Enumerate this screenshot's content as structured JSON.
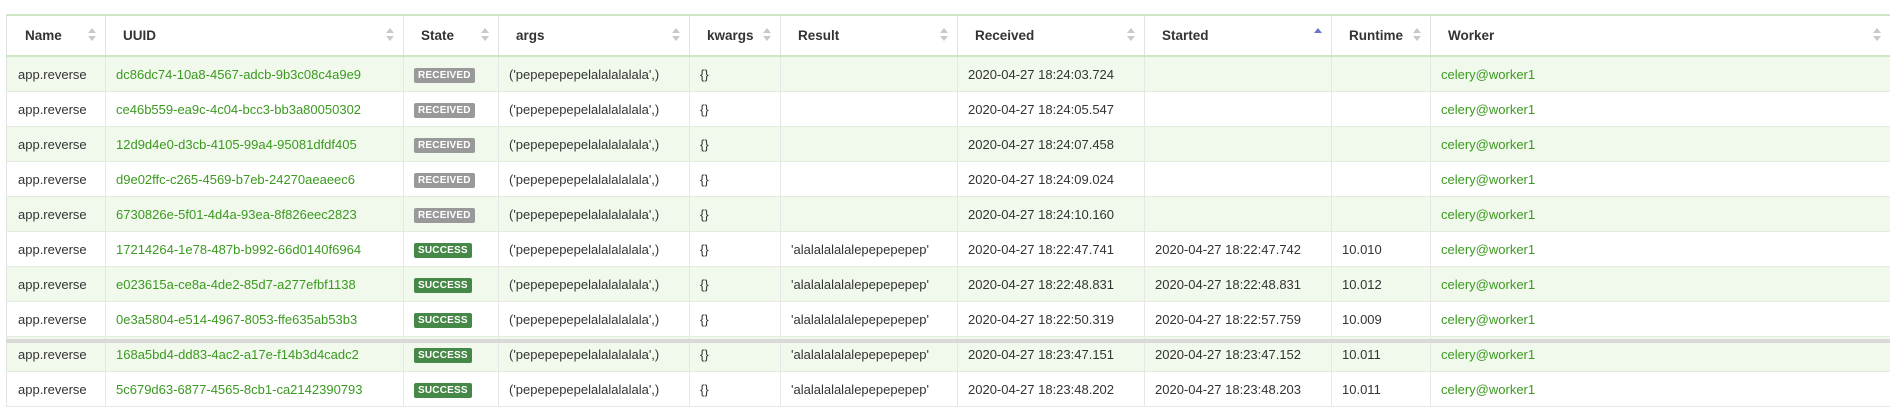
{
  "columns": [
    "Name",
    "UUID",
    "State",
    "args",
    "kwargs",
    "Result",
    "Received",
    "Started",
    "Runtime",
    "Worker"
  ],
  "sort_active_column": "Started",
  "state_colors": {
    "RECEIVED": "#999999",
    "SUCCESS": "#468847"
  },
  "link_color": "#3a9a1f",
  "rows": [
    {
      "name": "app.reverse",
      "uuid": "dc86dc74-10a8-4567-adcb-9b3c08c4a9e9",
      "state": "RECEIVED",
      "args": "('pepepepepelalalalalala',)",
      "kwargs": "{}",
      "result": "",
      "received": "2020-04-27 18:24:03.724",
      "started": "",
      "runtime": "",
      "worker": "celery@worker1"
    },
    {
      "name": "app.reverse",
      "uuid": "ce46b559-ea9c-4c04-bcc3-bb3a80050302",
      "state": "RECEIVED",
      "args": "('pepepepepelalalalalala',)",
      "kwargs": "{}",
      "result": "",
      "received": "2020-04-27 18:24:05.547",
      "started": "",
      "runtime": "",
      "worker": "celery@worker1"
    },
    {
      "name": "app.reverse",
      "uuid": "12d9d4e0-d3cb-4105-99a4-95081dfdf405",
      "state": "RECEIVED",
      "args": "('pepepepepelalalalalala',)",
      "kwargs": "{}",
      "result": "",
      "received": "2020-04-27 18:24:07.458",
      "started": "",
      "runtime": "",
      "worker": "celery@worker1"
    },
    {
      "name": "app.reverse",
      "uuid": "d9e02ffc-c265-4569-b7eb-24270aeaeec6",
      "state": "RECEIVED",
      "args": "('pepepepepelalalalalala',)",
      "kwargs": "{}",
      "result": "",
      "received": "2020-04-27 18:24:09.024",
      "started": "",
      "runtime": "",
      "worker": "celery@worker1"
    },
    {
      "name": "app.reverse",
      "uuid": "6730826e-5f01-4d4a-93ea-8f826eec2823",
      "state": "RECEIVED",
      "args": "('pepepepepelalalalalala',)",
      "kwargs": "{}",
      "result": "",
      "received": "2020-04-27 18:24:10.160",
      "started": "",
      "runtime": "",
      "worker": "celery@worker1"
    },
    {
      "name": "app.reverse",
      "uuid": "17214264-1e78-487b-b992-66d0140f6964",
      "state": "SUCCESS",
      "args": "('pepepepepelalalalalala',)",
      "kwargs": "{}",
      "result": "'alalalalalalepepepepep'",
      "received": "2020-04-27 18:22:47.741",
      "started": "2020-04-27 18:22:47.742",
      "runtime": "10.010",
      "worker": "celery@worker1"
    },
    {
      "name": "app.reverse",
      "uuid": "e023615a-ce8a-4de2-85d7-a277efbf1138",
      "state": "SUCCESS",
      "args": "('pepepepepelalalalalala',)",
      "kwargs": "{}",
      "result": "'alalalalalalepepepepep'",
      "received": "2020-04-27 18:22:48.831",
      "started": "2020-04-27 18:22:48.831",
      "runtime": "10.012",
      "worker": "celery@worker1"
    },
    {
      "name": "app.reverse",
      "uuid": "0e3a5804-e514-4967-8053-ffe635ab53b3",
      "state": "SUCCESS",
      "args": "('pepepepepelalalalalala',)",
      "kwargs": "{}",
      "result": "'alalalalalalepepepepep'",
      "received": "2020-04-27 18:22:50.319",
      "started": "2020-04-27 18:22:57.759",
      "runtime": "10.009",
      "worker": "celery@worker1"
    },
    {
      "name": "app.reverse",
      "uuid": "168a5bd4-dd83-4ac2-a17e-f14b3d4cadc2",
      "state": "SUCCESS",
      "args": "('pepepepepelalalalalala',)",
      "kwargs": "{}",
      "result": "'alalalalalalepepepepep'",
      "received": "2020-04-27 18:23:47.151",
      "started": "2020-04-27 18:23:47.152",
      "runtime": "10.011",
      "worker": "celery@worker1"
    },
    {
      "name": "app.reverse",
      "uuid": "5c679d63-6877-4565-8cb1-ca2142390793",
      "state": "SUCCESS",
      "args": "('pepepepepelalalalalala',)",
      "kwargs": "{}",
      "result": "'alalalalalalepepepepep'",
      "received": "2020-04-27 18:23:48.202",
      "started": "2020-04-27 18:23:48.203",
      "runtime": "10.011",
      "worker": "celery@worker1"
    }
  ]
}
